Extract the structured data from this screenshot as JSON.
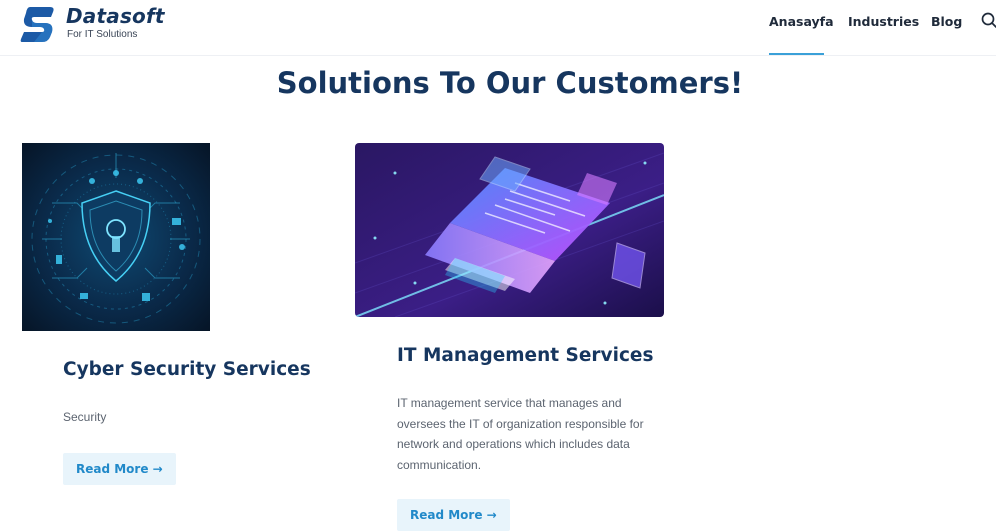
{
  "brand": {
    "name": "Datasoft",
    "tagline": "For IT Solutions"
  },
  "nav": {
    "items": [
      {
        "label": "Anasayfa",
        "active": true
      },
      {
        "label": "Industries",
        "active": false
      },
      {
        "label": "Blog",
        "active": false
      }
    ],
    "search_icon": "search-icon"
  },
  "main": {
    "title": "Solutions To Our Customers!",
    "cards": [
      {
        "image": "cyber-security-shield-illustration",
        "title": "Cyber Security Services",
        "text": "Security",
        "cta": "Read More →"
      },
      {
        "image": "isometric-laptop-illustration",
        "title": "IT Management Services",
        "text": "IT management service that manages and oversees the IT of organization responsible for network and operations which includes data communication.",
        "cta": "Read More →"
      }
    ]
  },
  "colors": {
    "brand_navy": "#16365f",
    "accent_blue": "#2189c9",
    "underline": "#3aa0d8",
    "button_bg": "#e8f4fb"
  }
}
